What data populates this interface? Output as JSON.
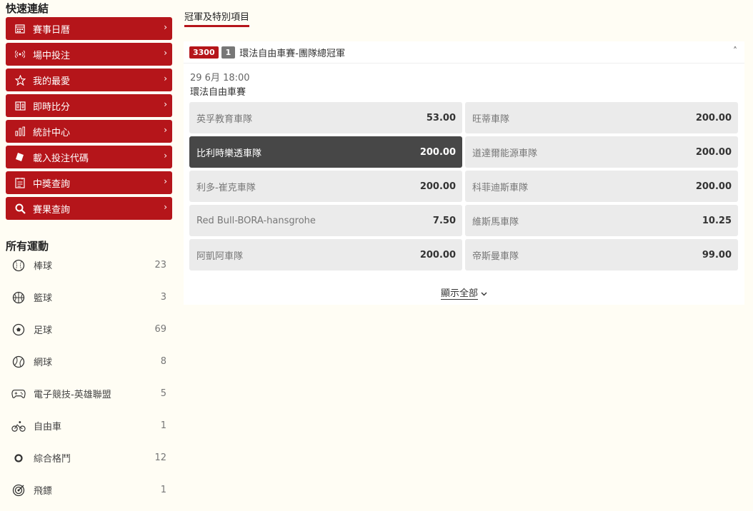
{
  "sidebar": {
    "quick_title": "快速連結",
    "quick_links": [
      {
        "label": "賽事日曆",
        "icon": "calendar-icon"
      },
      {
        "label": "場中投注",
        "icon": "live-signal-icon"
      },
      {
        "label": "我的最愛",
        "icon": "star-icon"
      },
      {
        "label": "即時比分",
        "icon": "scoreboard-icon"
      },
      {
        "label": "統計中心",
        "icon": "bar-chart-icon"
      },
      {
        "label": "載入投注代碼",
        "icon": "ticket-icon"
      },
      {
        "label": "中獎查詢",
        "icon": "checklist-icon"
      },
      {
        "label": "賽果查詢",
        "icon": "search-icon"
      }
    ],
    "arrow": "›",
    "sports_title": "所有運動",
    "sports": [
      {
        "label": "棒球",
        "count": "23",
        "icon": "baseball-icon"
      },
      {
        "label": "籃球",
        "count": "3",
        "icon": "basketball-icon"
      },
      {
        "label": "足球",
        "count": "69",
        "icon": "soccer-ball-icon"
      },
      {
        "label": "網球",
        "count": "8",
        "icon": "tennis-ball-icon"
      },
      {
        "label": "電子競技-英雄聯盟",
        "count": "5",
        "icon": "gamepad-icon"
      },
      {
        "label": "自由車",
        "count": "1",
        "icon": "bicycle-icon"
      },
      {
        "label": "綜合格鬥",
        "count": "12",
        "icon": "ring-icon"
      },
      {
        "label": "飛鏢",
        "count": "1",
        "icon": "dartboard-icon"
      }
    ]
  },
  "main": {
    "tab_label": "冠軍及特別項目",
    "card": {
      "code": "3300",
      "num": "1",
      "title": "環法自由車賽-團隊總冠軍",
      "collapse": "˄",
      "datetime": "29 6月  18:00",
      "event": "環法自由車賽",
      "selections": [
        {
          "name": "英孚教育車隊",
          "odds": "53.00",
          "selected": false
        },
        {
          "name": "旺蒂車隊",
          "odds": "200.00",
          "selected": false
        },
        {
          "name": "比利時樂透車隊",
          "odds": "200.00",
          "selected": true
        },
        {
          "name": "道達爾能源車隊",
          "odds": "200.00",
          "selected": false
        },
        {
          "name": "利多-崔克車隊",
          "odds": "200.00",
          "selected": false
        },
        {
          "name": "科菲迪斯車隊",
          "odds": "200.00",
          "selected": false
        },
        {
          "name": "Red Bull-BORA-hansgrohe",
          "odds": "7.50",
          "selected": false
        },
        {
          "name": "維斯馬車隊",
          "odds": "10.25",
          "selected": false
        },
        {
          "name": "阿凱阿車隊",
          "odds": "200.00",
          "selected": false
        },
        {
          "name": "帝斯曼車隊",
          "odds": "99.00",
          "selected": false
        }
      ],
      "show_all": "顯示全部",
      "show_all_chevron": "⌄"
    }
  },
  "colors": {
    "accent": "#b5151a",
    "background": "#fffdf4",
    "selected": "#474747",
    "cell": "#ebebeb"
  }
}
